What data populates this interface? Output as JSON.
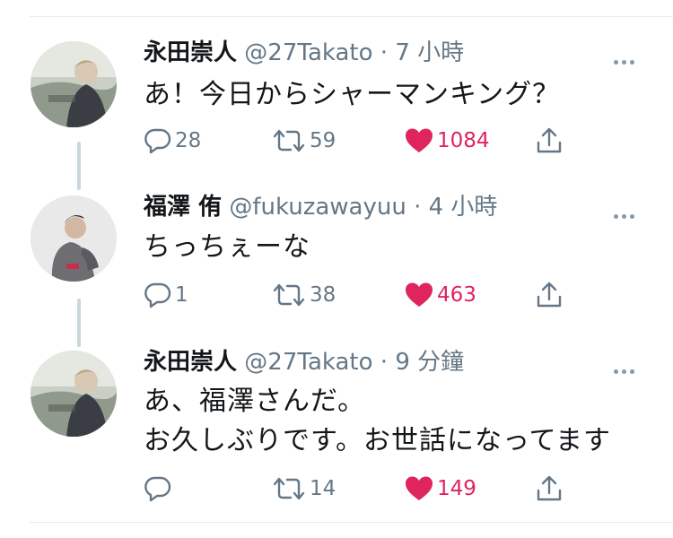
{
  "colors": {
    "text_primary": "#14171a",
    "text_secondary": "#657786",
    "like_active": "#e0245e",
    "thread_line": "#ccd6dd",
    "divider": "#e6ecf0"
  },
  "tweets": [
    {
      "name": "永田崇人",
      "handle": "@27Takato",
      "time": "7 小時",
      "text": "あ！今日からシャーマンキング？",
      "replies": "28",
      "retweets": "59",
      "likes": "1084",
      "liked": true,
      "avatar_icon": "profile-photo"
    },
    {
      "name": "福澤 侑",
      "handle": "@fukuzawayuu",
      "time": "4 小時",
      "text": "ちっちぇーな",
      "replies": "1",
      "retweets": "38",
      "likes": "463",
      "liked": true,
      "avatar_icon": "profile-photo"
    },
    {
      "name": "永田崇人",
      "handle": "@27Takato",
      "time": "9 分鐘",
      "text": "あ、福澤さんだ。\nお久しぶりです。お世話になってます",
      "replies": "",
      "retweets": "14",
      "likes": "149",
      "liked": true,
      "avatar_icon": "profile-photo"
    }
  ]
}
